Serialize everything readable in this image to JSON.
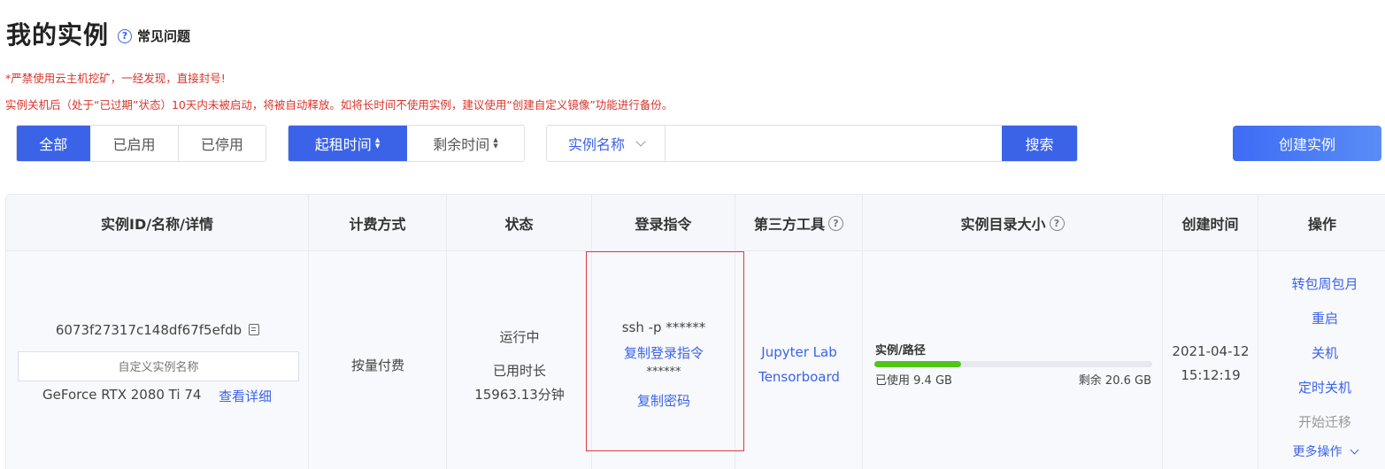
{
  "header": {
    "title": "我的实例",
    "faq_label": "常见问题"
  },
  "warnings": {
    "line1": "*严禁使用云主机挖矿，一经发现，直接封号!",
    "line2": "实例关机后（处于“已过期”状态）10天内未被启动，将被自动释放。如将长时间不使用实例，建议使用“创建自定义镜像”功能进行备份。"
  },
  "filters": {
    "status_tabs": [
      "全部",
      "已启用",
      "已停用"
    ],
    "sort_tabs": [
      "起租时间",
      "剩余时间"
    ]
  },
  "search": {
    "field_label": "实例名称",
    "placeholder": "",
    "button_label": "搜索"
  },
  "create_button": "创建实例",
  "table": {
    "headers": [
      "实例ID/名称/详情",
      "计费方式",
      "状态",
      "登录指令",
      "第三方工具",
      "实例目录大小",
      "创建时间",
      "操作"
    ],
    "row": {
      "instance_id": "6073f27317c148df67f5efdb",
      "name_placeholder": "自定义实例名称",
      "gpu": "GeForce RTX 2080 Ti 74",
      "view_details": "查看详细",
      "billing": "按量付费",
      "status": "运行中",
      "used_label": "已用时长",
      "used_value": "15963.13分钟",
      "ssh": "ssh -p ******",
      "copy_login": "复制登录指令",
      "password": "******",
      "copy_password": "复制密码",
      "tools": [
        "Jupyter Lab",
        "Tensorboard"
      ],
      "dir_label": "实例/路径",
      "used_storage": "已使用 9.4 GB",
      "remaining_storage": "剩余 20.6 GB",
      "storage_used_fraction": 0.313,
      "created_date": "2021-04-12",
      "created_time": "15:12:19",
      "actions": [
        "转包周包月",
        "重启",
        "关机",
        "定时关机",
        "开始迁移"
      ],
      "more_actions": "更多操作"
    }
  },
  "colors": {
    "primary": "#3b63e8",
    "warning": "#d9352c",
    "progress": "#52c41a",
    "disabled_text": "#999999"
  }
}
